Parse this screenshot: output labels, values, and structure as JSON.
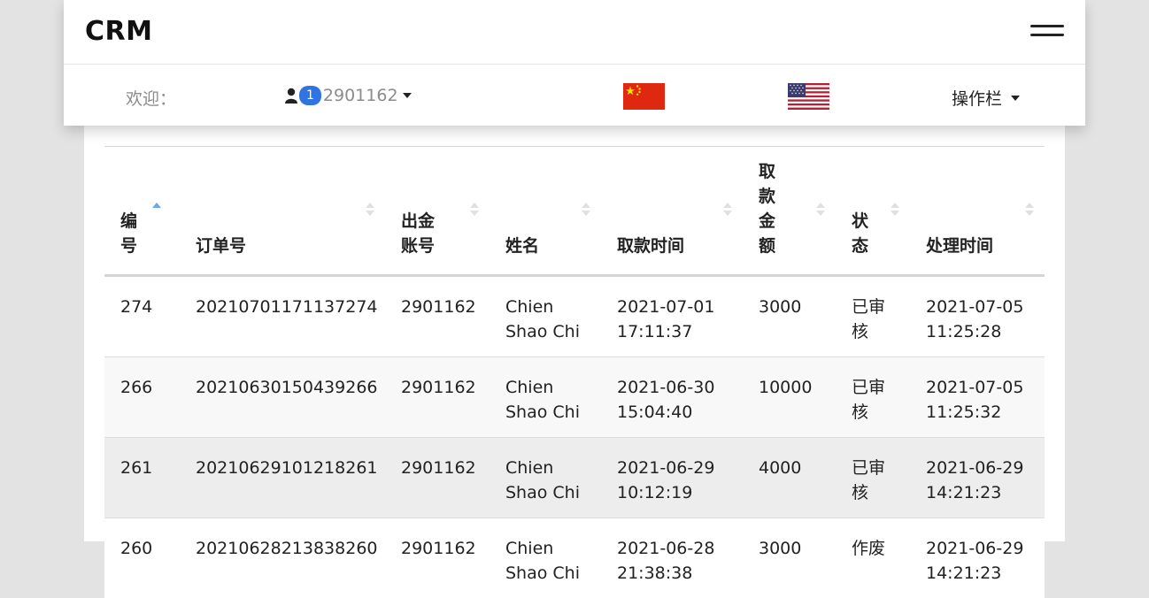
{
  "header": {
    "brand": "CRM",
    "welcome": "欢迎：",
    "user_badge": "1",
    "user_id": "2901162",
    "ops_label": "操作栏"
  },
  "table": {
    "columns": [
      "编\n号",
      "订单号",
      "出金\n账号",
      "姓名",
      "取款时间",
      "取\n款\n金\n额",
      "状\n态",
      "处理时间"
    ],
    "rows": [
      [
        "274",
        "20210701171137274",
        "2901162",
        "Chien\nShao Chi",
        "2021-07-01\n17:11:37",
        "3000",
        "已审\n核",
        "2021-07-05\n11:25:28"
      ],
      [
        "266",
        "20210630150439266",
        "2901162",
        "Chien\nShao Chi",
        "2021-06-30\n15:04:40",
        "10000",
        "已审\n核",
        "2021-07-05\n11:25:32"
      ],
      [
        "261",
        "20210629101218261",
        "2901162",
        "Chien\nShao Chi",
        "2021-06-29\n10:12:19",
        "4000",
        "已审\n核",
        "2021-06-29\n14:21:23"
      ],
      [
        "260",
        "20210628213838260",
        "2901162",
        "Chien\nShao Chi",
        "2021-06-28\n21:38:38",
        "3000",
        "作废",
        "2021-06-29\n14:21:23"
      ]
    ]
  },
  "icons": {
    "user": "user-icon",
    "menu": "hamburger-menu-icon",
    "flag_cn": "china-flag-icon",
    "flag_us": "usa-flag-icon",
    "sort": "sort-icon"
  },
  "colors": {
    "badge": "#2f74e0",
    "sort_active": "#6ea8e6"
  }
}
